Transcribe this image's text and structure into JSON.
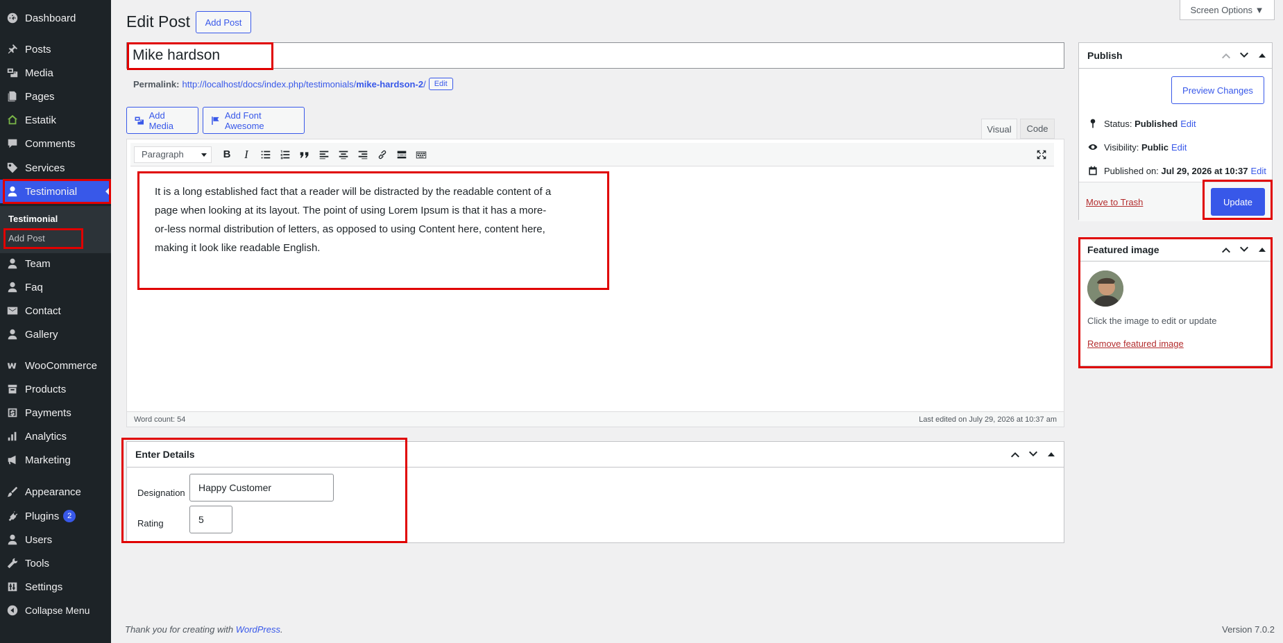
{
  "sidebar": {
    "items": [
      {
        "label": "Dashboard",
        "icon": "dashboard-icon"
      },
      {
        "label": "Posts",
        "icon": "pin-icon"
      },
      {
        "label": "Media",
        "icon": "media-icon"
      },
      {
        "label": "Pages",
        "icon": "pages-icon"
      },
      {
        "label": "Estatik",
        "icon": "house-icon"
      },
      {
        "label": "Comments",
        "icon": "comment-icon"
      },
      {
        "label": "Services",
        "icon": "tag-icon"
      },
      {
        "label": "Testimonial",
        "icon": "user-icon"
      },
      {
        "label": "Team",
        "icon": "user-icon"
      },
      {
        "label": "Faq",
        "icon": "user-icon"
      },
      {
        "label": "Contact",
        "icon": "mail-icon"
      },
      {
        "label": "Gallery",
        "icon": "user-icon"
      },
      {
        "label": "WooCommerce",
        "icon": "woo-icon"
      },
      {
        "label": "Products",
        "icon": "archive-icon"
      },
      {
        "label": "Payments",
        "icon": "dollar-icon"
      },
      {
        "label": "Analytics",
        "icon": "bar-chart-icon"
      },
      {
        "label": "Marketing",
        "icon": "megaphone-icon"
      },
      {
        "label": "Appearance",
        "icon": "brush-icon"
      },
      {
        "label": "Plugins",
        "icon": "plug-icon"
      },
      {
        "label": "Users",
        "icon": "user-icon"
      },
      {
        "label": "Tools",
        "icon": "wrench-icon"
      },
      {
        "label": "Settings",
        "icon": "settings-icon"
      },
      {
        "label": "Collapse Menu",
        "icon": "collapse-icon"
      }
    ],
    "plugins_badge": "2",
    "submenu": {
      "title": "Testimonial",
      "add_post": "Add Post"
    }
  },
  "header": {
    "title": "Edit Post",
    "add_post_button": "Add Post",
    "screen_options": "Screen Options ▼"
  },
  "post": {
    "title": "Mike hardson",
    "permalink_label": "Permalink:",
    "permalink_base": "http://localhost/docs/index.php/testimonials/",
    "permalink_slug": "mike-hardson-2",
    "permalink_trail": "/",
    "permalink_edit": "Edit"
  },
  "editor": {
    "add_media": "Add Media",
    "add_font_awesome": "Add Font Awesome",
    "tab_visual": "Visual",
    "tab_code": "Code",
    "format_select": "Paragraph",
    "content": "It is a long established fact that a reader will be distracted by the readable content of a page when looking at its layout. The point of using Lorem Ipsum is that it has a more-or-less normal distribution of letters, as opposed to using Content here, content here, making it look like readable English.",
    "word_count": "Word count: 54",
    "last_edited": "Last edited on July 29, 2026 at 10:37 am"
  },
  "details": {
    "title": "Enter Details",
    "designation_label": "Designation",
    "designation_value": "Happy Customer",
    "rating_label": "Rating",
    "rating_value": "5"
  },
  "publish": {
    "title": "Publish",
    "preview_button": "Preview Changes",
    "status_label": "Status:",
    "status_value": "Published",
    "visibility_label": "Visibility:",
    "visibility_value": "Public",
    "published_label": "Published on:",
    "published_value": "Jul 29, 2026 at 10:37",
    "edit_link": "Edit",
    "trash_link": "Move to Trash",
    "update_button": "Update"
  },
  "featured": {
    "title": "Featured image",
    "hint": "Click the image to edit or update",
    "remove_link": "Remove featured image"
  },
  "footer": {
    "thanks_prefix": "Thank you for creating with",
    "wordpress_link": "WordPress",
    "thanks_suffix": ".",
    "version": "Version 7.0.2"
  },
  "colors": {
    "accent": "#3858e9",
    "sidebar_bg": "#1d2327",
    "highlight": "#e00000"
  }
}
